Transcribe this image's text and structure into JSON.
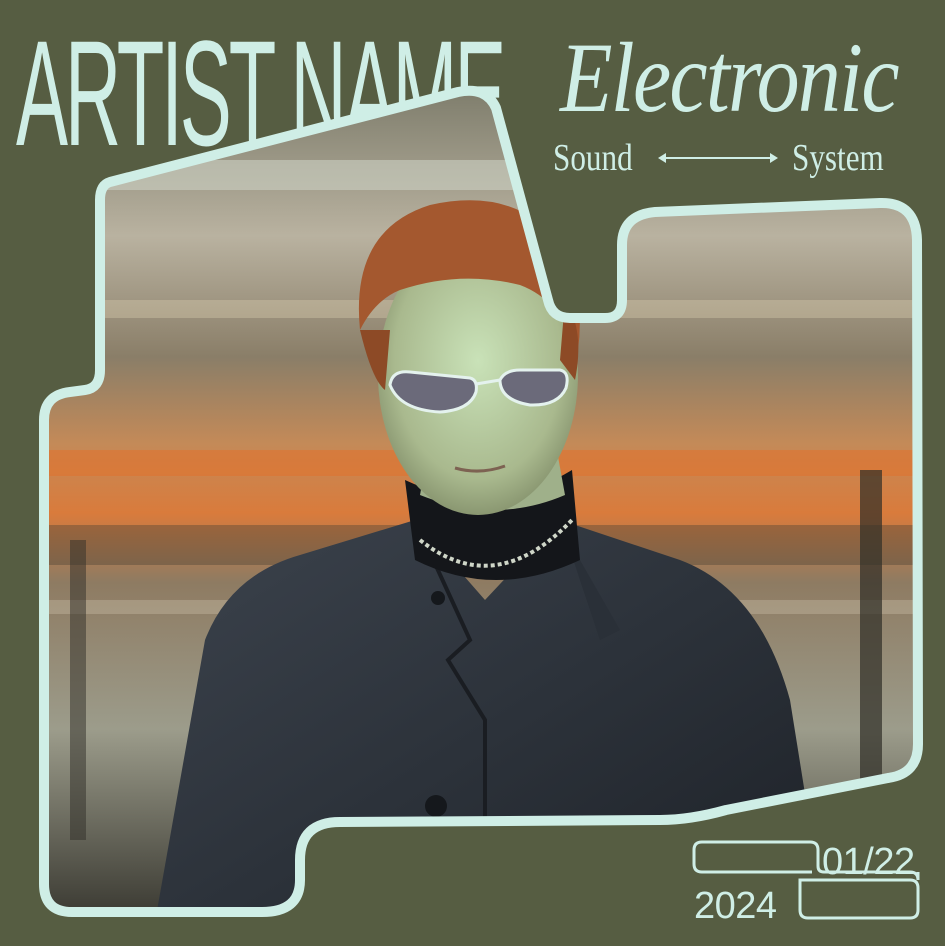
{
  "cover": {
    "artist_name": "ARTIST NAME",
    "genre": "Electronic",
    "subtitle_left": "Sound",
    "subtitle_right": "System",
    "date": "01/22",
    "year": "2024"
  },
  "colors": {
    "background": "#565d42",
    "accent": "#cfeee6",
    "frame_stroke": "#cfeee6"
  },
  "icons": {
    "arrow": "double-headed-arrow-icon"
  }
}
